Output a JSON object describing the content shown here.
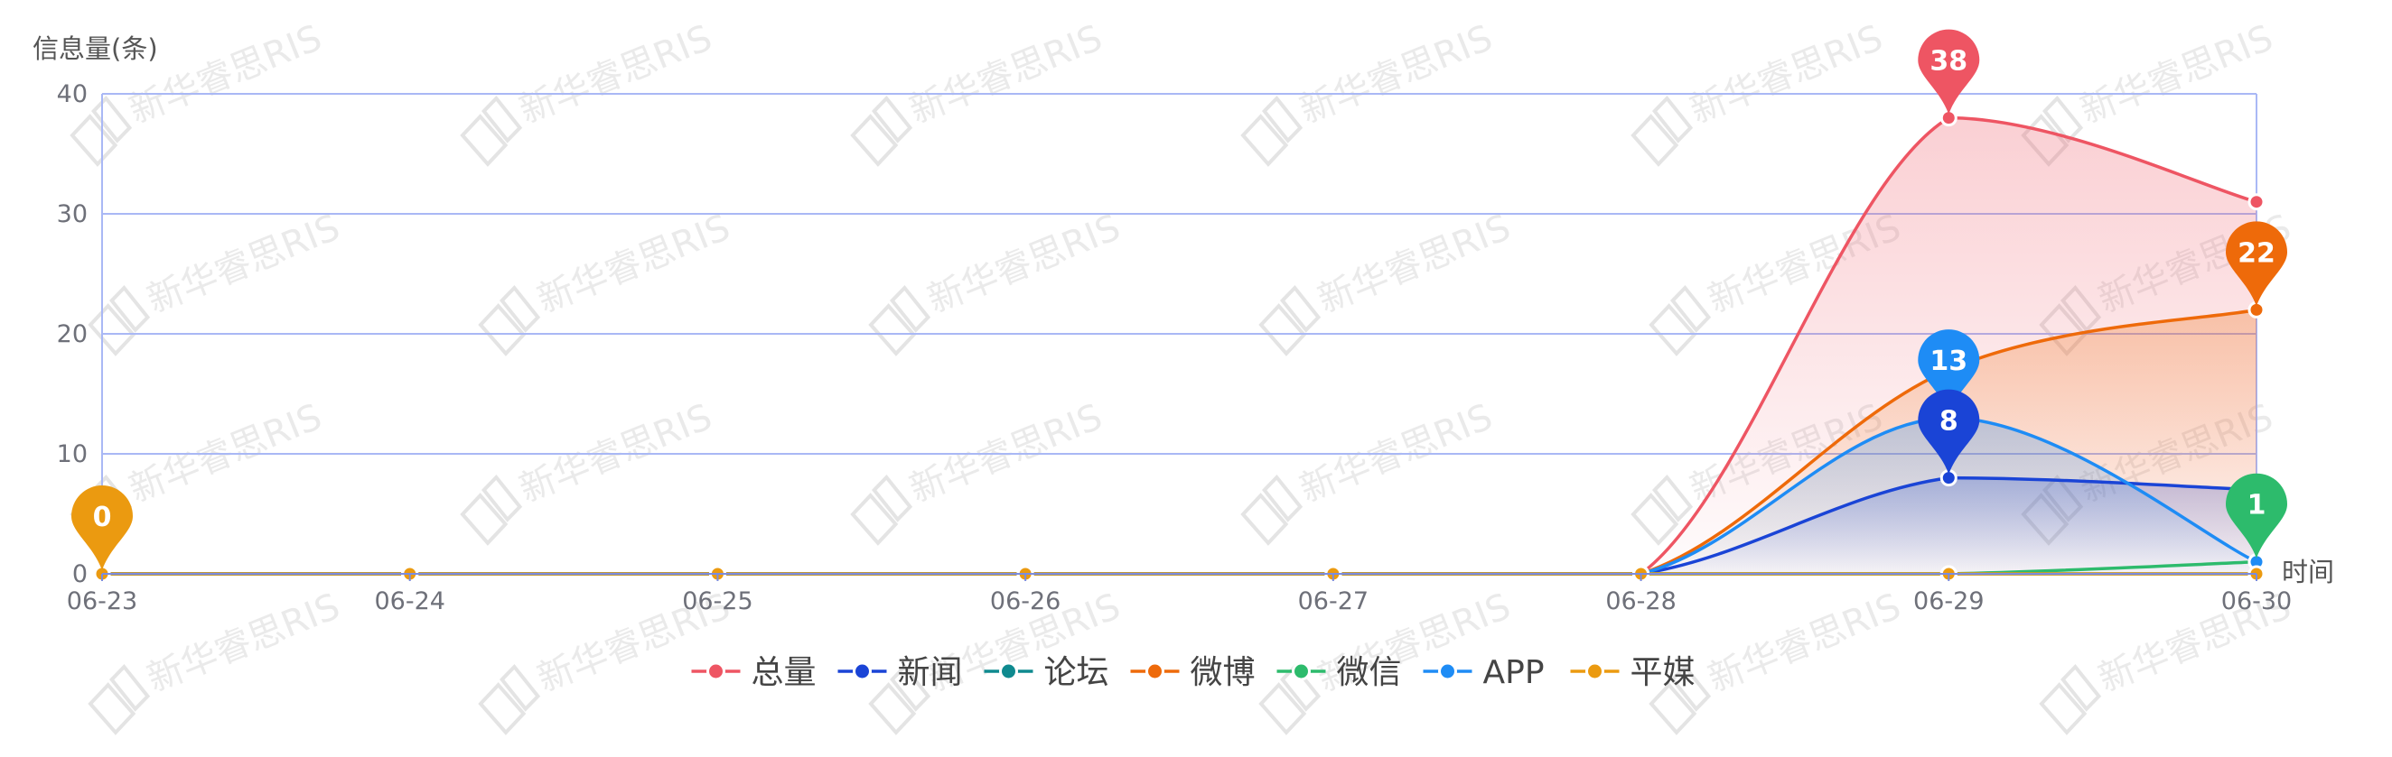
{
  "chart_data": {
    "type": "line",
    "ylabel": "信息量(条)",
    "xlabel": "时间",
    "ylim": [
      0,
      40
    ],
    "y_ticks": [
      "0",
      "10",
      "20",
      "30",
      "40"
    ],
    "categories": [
      "06-23",
      "06-24",
      "06-25",
      "06-26",
      "06-27",
      "06-28",
      "06-29",
      "06-30"
    ],
    "grid": true,
    "legend_position": "bottom-center",
    "series": [
      {
        "name": "总量",
        "color": "#ee5563",
        "values": [
          0,
          0,
          0,
          0,
          0,
          0,
          38,
          31
        ],
        "area": true
      },
      {
        "name": "新闻",
        "color": "#1a44d6",
        "values": [
          0,
          0,
          0,
          0,
          0,
          0,
          8,
          7
        ],
        "area": true
      },
      {
        "name": "论坛",
        "color": "#0f8a8f",
        "values": [
          0,
          0,
          0,
          0,
          0,
          0,
          0,
          0
        ],
        "area": false
      },
      {
        "name": "微博",
        "color": "#ee6a0a",
        "values": [
          0,
          0,
          0,
          0,
          0,
          0,
          17,
          22
        ],
        "area": true
      },
      {
        "name": "微信",
        "color": "#2dbb6c",
        "values": [
          0,
          0,
          0,
          0,
          0,
          0,
          0,
          1
        ],
        "area": false
      },
      {
        "name": "APP",
        "color": "#1e8cf5",
        "values": [
          0,
          0,
          0,
          0,
          0,
          0,
          13,
          1
        ],
        "area": true
      },
      {
        "name": "平媒",
        "color": "#eb9a10",
        "values": [
          0,
          0,
          0,
          0,
          0,
          0,
          0,
          0
        ],
        "area": false
      }
    ],
    "annotations": [
      {
        "series": "总量",
        "category": "06-29",
        "label": "38",
        "color": "#ee5563"
      },
      {
        "series": "微博",
        "category": "06-30",
        "label": "22",
        "color": "#ee6a0a"
      },
      {
        "series": "APP",
        "category": "06-29",
        "label": "13",
        "color": "#1e8cf5"
      },
      {
        "series": "新闻",
        "category": "06-29",
        "label": "8",
        "color": "#1a44d6"
      },
      {
        "series": "微信",
        "category": "06-30",
        "label": "1",
        "color": "#2dbb6c"
      },
      {
        "series": "平媒",
        "category": "06-23",
        "label": "0",
        "color": "#eb9a10"
      }
    ]
  },
  "watermark": {
    "text": "新华睿思RIS"
  }
}
